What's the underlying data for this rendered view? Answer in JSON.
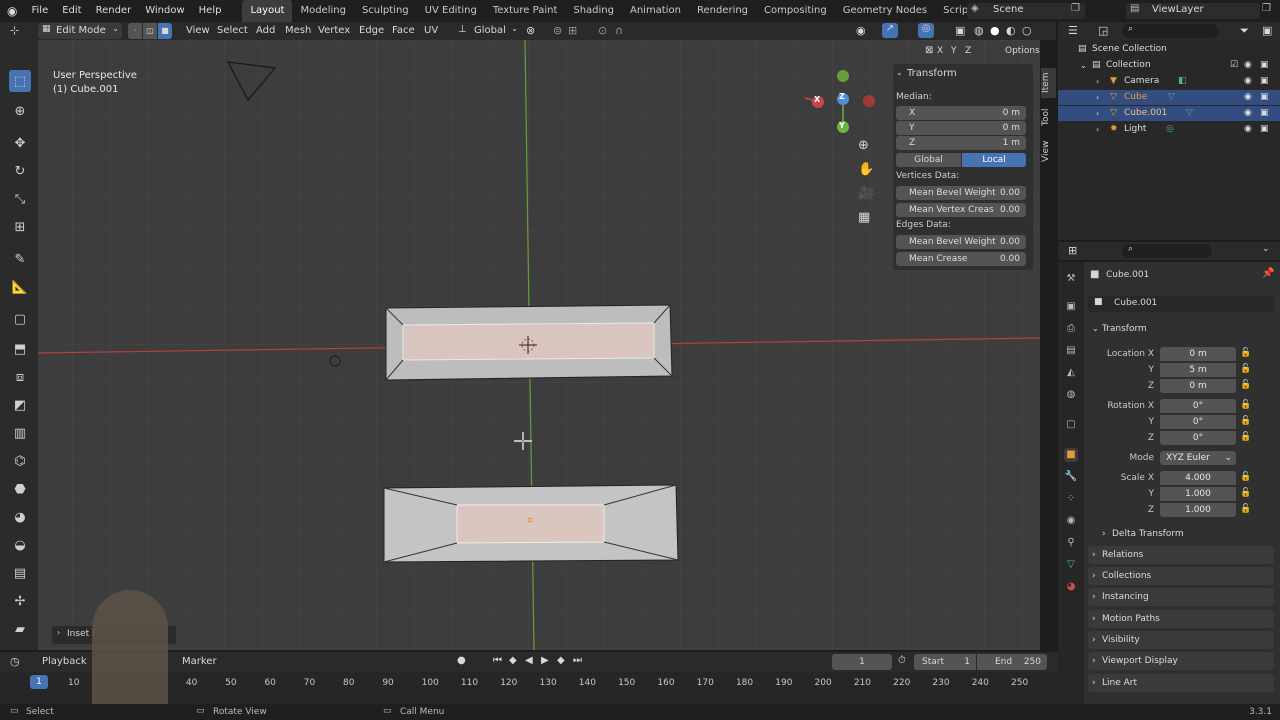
{
  "menu": [
    "File",
    "Edit",
    "Render",
    "Window",
    "Help"
  ],
  "workspaces": [
    {
      "label": "Layout",
      "active": true
    },
    {
      "label": "Modeling"
    },
    {
      "label": "Sculpting"
    },
    {
      "label": "UV Editing"
    },
    {
      "label": "Texture Paint"
    },
    {
      "label": "Shading"
    },
    {
      "label": "Animation"
    },
    {
      "label": "Rendering"
    },
    {
      "label": "Compositing"
    },
    {
      "label": "Geometry Nodes"
    },
    {
      "label": "Scripting"
    }
  ],
  "scene": "Scene",
  "view_layer": "ViewLayer",
  "viewport_header": {
    "mode": "Edit Mode",
    "menus": [
      "View",
      "Select",
      "Add",
      "Mesh",
      "Vertex",
      "Edge",
      "Face",
      "UV"
    ],
    "orientation": "Global",
    "axes": [
      "X",
      "Y",
      "Z"
    ],
    "options": "Options"
  },
  "viewport": {
    "view_name": "User Perspective",
    "object_name": "(1) Cube.001",
    "last_op": "Inset F"
  },
  "npanel": {
    "title": "Transform",
    "median": "Median:",
    "x_label": "X",
    "x_val": "0 m",
    "y_label": "Y",
    "y_val": "0 m",
    "z_label": "Z",
    "z_val": "1 m",
    "global": "Global",
    "local": "Local",
    "vertices_data": "Vertices Data:",
    "mean_bevel_weight": "Mean Bevel Weight",
    "mean_bevel_weight_val": "0.00",
    "mean_vertex_crease": "Mean Vertex Creas",
    "mean_vertex_crease_val": "0.00",
    "edges_data": "Edges Data:",
    "edge_bevel_weight": "Mean Bevel Weight",
    "edge_bevel_weight_val": "0.00",
    "mean_crease": "Mean Crease",
    "mean_crease_val": "0.00",
    "tabs": [
      "Item",
      "Tool",
      "View"
    ]
  },
  "outliner": {
    "scene_collection": "Scene Collection",
    "collection": "Collection",
    "items": [
      "Camera",
      "Cube",
      "Cube.001",
      "Light"
    ]
  },
  "properties": {
    "object_name": "Cube.001",
    "data_name": "Cube.001",
    "transform": "Transform",
    "location_label": "Location X",
    "loc_x": "0 m",
    "loc_y": "5 m",
    "loc_z": "0 m",
    "rotation_label": "Rotation X",
    "rot_x": "0°",
    "rot_y": "0°",
    "rot_z": "0°",
    "mode_label": "Mode",
    "mode_val": "XYZ Euler",
    "scale_label": "Scale X",
    "scale_x": "4.000",
    "scale_y": "1.000",
    "scale_z": "1.000",
    "y_label": "Y",
    "z_label": "Z",
    "panels": [
      "Delta Transform",
      "Relations",
      "Collections",
      "Instancing",
      "Motion Paths",
      "Visibility",
      "Viewport Display",
      "Line Art"
    ]
  },
  "timeline": {
    "playback": "Playback",
    "marker": "Marker",
    "current_frame": "1",
    "start_label": "Start",
    "start_val": "1",
    "end_label": "End",
    "end_val": "250",
    "ticks": [
      "10",
      "40",
      "50",
      "60",
      "70",
      "80",
      "90",
      "100",
      "110",
      "120",
      "130",
      "140",
      "150",
      "160",
      "170",
      "180",
      "190",
      "200",
      "210",
      "220",
      "230",
      "240",
      "250"
    ],
    "frame_badge": "1"
  },
  "statusbar": {
    "select": "Select",
    "rotate_view": "Rotate View",
    "call_menu": "Call Menu",
    "version": "3.3.1"
  },
  "colors": {
    "accent": "#4772b3",
    "selected_row": "#334d80",
    "x_axis": "#c94545",
    "y_axis": "#6db33f",
    "z_axis": "#4d8fd6",
    "face_selected": "#e5c9bf"
  }
}
